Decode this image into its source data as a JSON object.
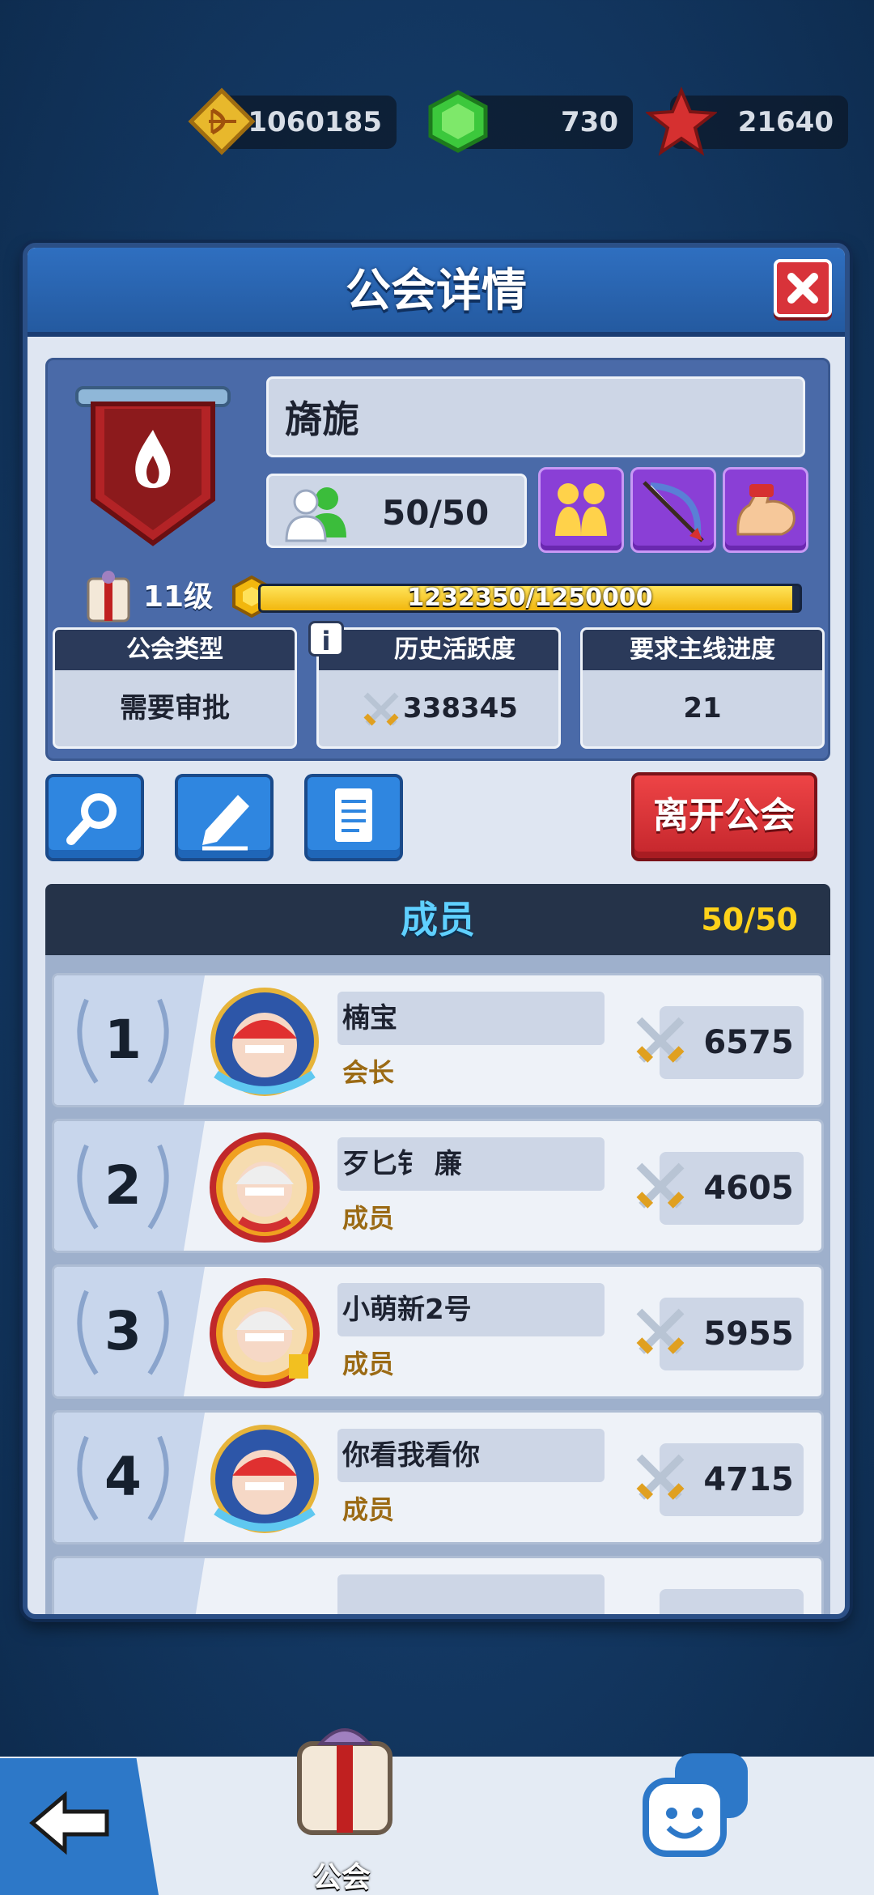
{
  "resources": [
    {
      "icon": "bow-icon",
      "value": "1060185"
    },
    {
      "icon": "green-gem-icon",
      "value": "730"
    },
    {
      "icon": "red-star-icon",
      "value": "21640"
    }
  ],
  "dialog": {
    "title": "公会详情",
    "close_icon": "close-icon"
  },
  "guild": {
    "name": "旖旎",
    "members": "50/50",
    "level": "11级",
    "xp_text": "1232350/1250000",
    "xp_progress": 0.9859,
    "stats": [
      {
        "label": "公会类型",
        "value": "需要审批"
      },
      {
        "label": "历史活跃度",
        "value": "338345"
      },
      {
        "label": "要求主线进度",
        "value": "21"
      }
    ],
    "perk_icons": [
      "handshake-icon",
      "bow-arrow-icon",
      "flexed-arm-icon"
    ]
  },
  "actions": {
    "search_icon": "search-icon",
    "edit_icon": "pencil-icon",
    "log_icon": "document-icon",
    "leave_label": "离开公会"
  },
  "members_section": {
    "title": "成员",
    "count": "50/50",
    "rows": [
      {
        "rank": "1",
        "name": "楠宝",
        "role": "会长",
        "score": "6575"
      },
      {
        "rank": "2",
        "name": "歹匕钅 廉",
        "role": "成员",
        "score": "4605"
      },
      {
        "rank": "3",
        "name": "小萌新2号",
        "role": "成员",
        "score": "5955"
      },
      {
        "rank": "4",
        "name": "你看我看你",
        "role": "成员",
        "score": "4715"
      }
    ]
  },
  "nav": {
    "guild_label": "公会"
  },
  "colors": {
    "panel_blue": "#2f6fc0",
    "leave_red": "#d8333a",
    "xp_yellow": "#f2b70e",
    "member_title": "#5fd0ff",
    "role_brown": "#9b6a14"
  }
}
